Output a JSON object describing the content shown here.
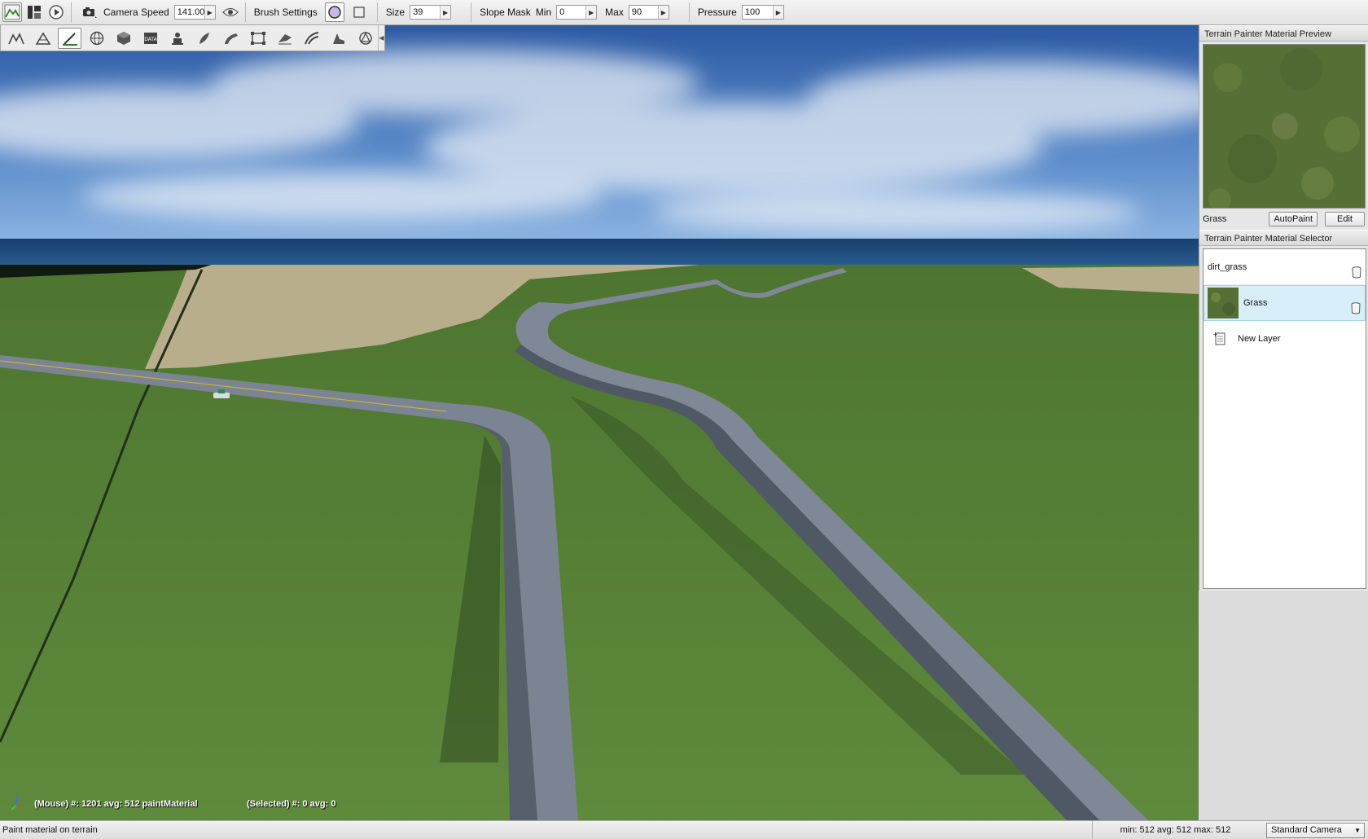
{
  "toolbar": {
    "camera_speed_label": "Camera Speed",
    "camera_speed_value": "141.00",
    "brush_settings_label": "Brush Settings",
    "size_label": "Size",
    "size_value": "39",
    "slope_mask_label": "Slope Mask",
    "min_label": "Min",
    "min_value": "0",
    "max_label": "Max",
    "max_value": "90",
    "pressure_label": "Pressure",
    "pressure_value": "100"
  },
  "palette": {
    "tools": [
      "terrain-raise-icon",
      "terrain-smooth-icon",
      "paint-material-icon",
      "globe-icon",
      "object-cube-icon",
      "datablock-icon",
      "spawn-icon",
      "forest-icon",
      "road-icon",
      "mesh-road-icon",
      "river-icon",
      "decal-icon",
      "meshes-icon",
      "nav-icon"
    ],
    "active_index": 2
  },
  "right_panel": {
    "preview_title": "Terrain Painter Material Preview",
    "preview_material_name": "Grass",
    "autopaint_label": "AutoPaint",
    "edit_label": "Edit",
    "selector_title": "Terrain Painter Material Selector",
    "materials": [
      {
        "name": "dirt_grass",
        "selected": false
      },
      {
        "name": "Grass",
        "selected": true
      }
    ],
    "new_layer_label": "New Layer"
  },
  "viewport": {
    "mouse_readout": "(Mouse) #: 1201  avg: 512 paintMaterial",
    "selected_readout": "(Selected) #: 0  avg: 0"
  },
  "status": {
    "message": "Paint material on terrain",
    "stats": "min: 512  avg: 512  max: 512",
    "camera_mode": "Standard Camera"
  },
  "colors": {
    "sky_top": "#2f5fa8",
    "sky_horizon": "#8fb7e4",
    "ocean": "#1f4f82",
    "grass": "#557f35",
    "sand": "#b8ad8a",
    "road": "#7d8694",
    "selection": "#d8eef8"
  }
}
